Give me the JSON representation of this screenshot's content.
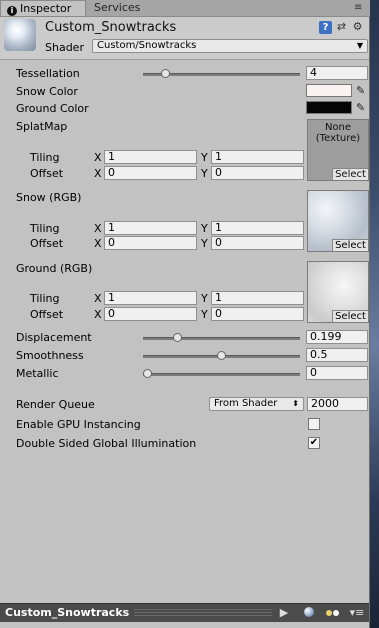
{
  "tabs": [
    {
      "label": "Inspector",
      "icon": "info-icon",
      "active": true
    },
    {
      "label": "Services",
      "active": false
    }
  ],
  "header": {
    "material_name": "Custom_Snowtracks",
    "shader_label": "Shader",
    "shader_value": "Custom/Snowtracks"
  },
  "properties": {
    "tessellation": {
      "label": "Tessellation",
      "value": "4",
      "level": 0.12
    },
    "snow_color": {
      "label": "Snow Color",
      "color": "#f8f2f2"
    },
    "ground_color": {
      "label": "Ground Color",
      "color": "#050505"
    },
    "splatmap": {
      "label": "SplatMap",
      "none_text_1": "None",
      "none_text_2": "(Texture)",
      "select": "Select",
      "tiling_label": "Tiling",
      "offset_label": "Offset",
      "tiling_x": "1",
      "tiling_y": "1",
      "offset_x": "0",
      "offset_y": "0"
    },
    "snow_rgb": {
      "label": "Snow (RGB)",
      "select": "Select",
      "tiling_label": "Tiling",
      "offset_label": "Offset",
      "tiling_x": "1",
      "tiling_y": "1",
      "offset_x": "0",
      "offset_y": "0"
    },
    "ground_rgb": {
      "label": "Ground (RGB)",
      "select": "Select",
      "tiling_label": "Tiling",
      "offset_label": "Offset",
      "tiling_x": "1",
      "tiling_y": "1",
      "offset_x": "0",
      "offset_y": "0"
    },
    "displacement": {
      "label": "Displacement",
      "value": "0.199",
      "level": 0.2
    },
    "smoothness": {
      "label": "Smoothness",
      "value": "0.5",
      "level": 0.5
    },
    "metallic": {
      "label": "Metallic",
      "value": "0",
      "level": 0.0
    }
  },
  "render_queue": {
    "label": "Render Queue",
    "dropdown": "From Shader",
    "value": "2000"
  },
  "gpu_instancing": {
    "label": "Enable GPU Instancing",
    "checked": false
  },
  "double_sided_gi": {
    "label": "Double Sided Global Illumination",
    "checked": true
  },
  "axis": {
    "x": "X",
    "y": "Y"
  },
  "bottom_bar": {
    "title": "Custom_Snowtracks"
  }
}
